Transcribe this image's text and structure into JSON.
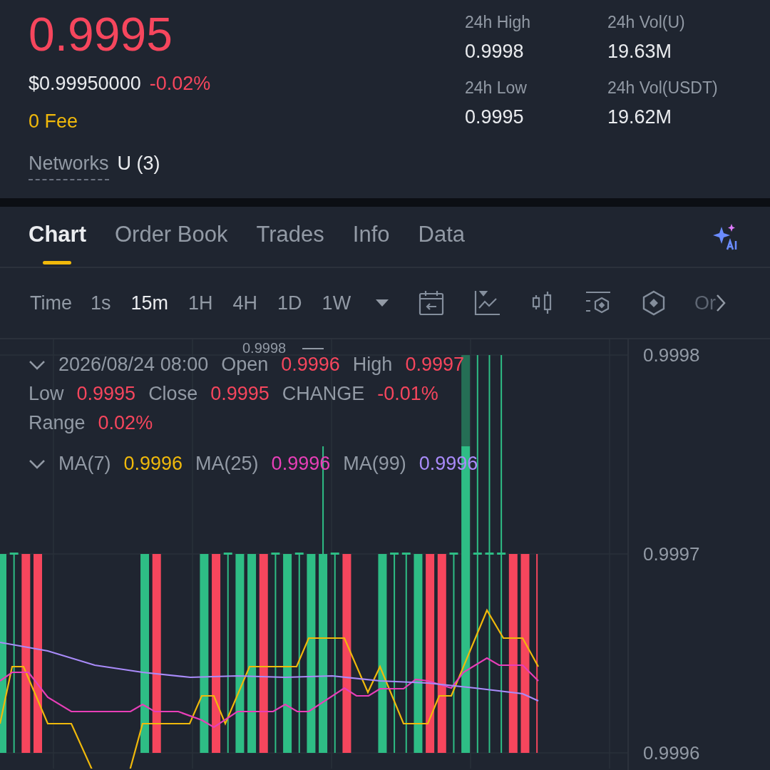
{
  "ticker": {
    "price": "0.9995",
    "usd_price": "$0.99950000",
    "change": "-0.02%",
    "fee": "0 Fee",
    "networks_label": "Networks",
    "networks_value": "U (3)"
  },
  "stats": [
    {
      "label": "24h High",
      "value": "0.9998"
    },
    {
      "label": "24h Vol(U)",
      "value": "19.63M"
    },
    {
      "label": "24h Low",
      "value": "0.9995"
    },
    {
      "label": "24h Vol(USDT)",
      "value": "19.62M"
    }
  ],
  "tabs": [
    {
      "label": "Chart",
      "selected": true
    },
    {
      "label": "Order Book",
      "selected": false
    },
    {
      "label": "Trades",
      "selected": false
    },
    {
      "label": "Info",
      "selected": false
    },
    {
      "label": "Data",
      "selected": false
    }
  ],
  "interval_label": "Time",
  "intervals": [
    {
      "label": "1s",
      "selected": false
    },
    {
      "label": "15m",
      "selected": true
    },
    {
      "label": "1H",
      "selected": false
    },
    {
      "label": "4H",
      "selected": false
    },
    {
      "label": "1D",
      "selected": false
    },
    {
      "label": "1W",
      "selected": false
    }
  ],
  "toolbar_more": "Or",
  "ohlc": {
    "datetime": "2026/08/24 08:00",
    "fields": [
      {
        "label": "Open",
        "value": "0.9996"
      },
      {
        "label": "High",
        "value": "0.9997"
      },
      {
        "label": "Low",
        "value": "0.9995"
      },
      {
        "label": "Close",
        "value": "0.9995"
      },
      {
        "label": "CHANGE",
        "value": "-0.01%"
      },
      {
        "label": "Range",
        "value": "0.02%"
      }
    ]
  },
  "moving_averages": [
    {
      "label": "MA(7)",
      "value": "0.9996",
      "color": "#f0b90b"
    },
    {
      "label": "MA(25)",
      "value": "0.9996",
      "color": "#e83fb8"
    },
    {
      "label": "MA(99)",
      "value": "0.9996",
      "color": "#a98bfa"
    }
  ],
  "chart": {
    "high_marker": "0.9998",
    "y_axis": [
      "0.9998",
      "0.9997",
      "0.9996"
    ]
  }
}
